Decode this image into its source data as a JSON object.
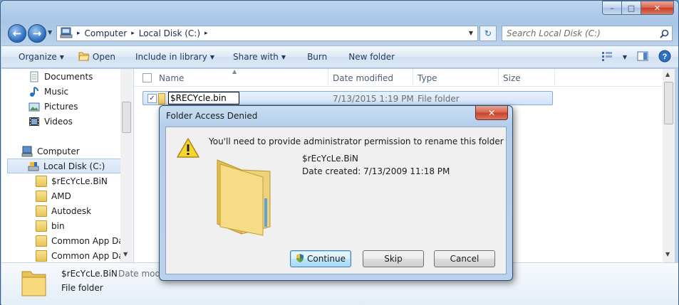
{
  "colors": {
    "title_gradient": "#a9c6e6",
    "selection": "#d2e3f7",
    "close_red": "#c6402a",
    "dialog_body": "#f0f0f0"
  },
  "address_bar": {
    "segments": [
      "Computer",
      "Local Disk (C:)"
    ],
    "separator": "▸"
  },
  "search": {
    "placeholder": "Search Local Disk (C:)"
  },
  "toolbar": {
    "organize": "Organize",
    "open": "Open",
    "include_in_library": "Include in library",
    "share_with": "Share with",
    "burn": "Burn",
    "new_folder": "New folder"
  },
  "nav_pane": {
    "items": [
      {
        "label": "Documents",
        "icon": "documents-icon"
      },
      {
        "label": "Music",
        "icon": "music-icon"
      },
      {
        "label": "Pictures",
        "icon": "pictures-icon"
      },
      {
        "label": "Videos",
        "icon": "videos-icon"
      },
      {
        "label": "Computer",
        "icon": "computer-icon"
      },
      {
        "label": "Local Disk (C:)",
        "icon": "drive-icon"
      },
      {
        "label": "$rEcYcLe.BiN",
        "icon": "folder-icon"
      },
      {
        "label": "AMD",
        "icon": "folder-icon"
      },
      {
        "label": "Autodesk",
        "icon": "folder-icon"
      },
      {
        "label": "bin",
        "icon": "folder-icon"
      },
      {
        "label": "Common App Data",
        "icon": "folder-icon"
      },
      {
        "label": "Common App Data",
        "icon": "folder-icon"
      }
    ]
  },
  "file_list": {
    "columns": [
      "Name",
      "Date modified",
      "Type",
      "Size"
    ],
    "rows": [
      {
        "name": "$RECYcle.bin",
        "date_modified": "7/13/2015 1:19 PM",
        "type": "File folder",
        "checked": true
      }
    ]
  },
  "details_pane": {
    "name": "$rEcYcLe.BiN",
    "modified_label": "Date modifi",
    "type": "File folder"
  },
  "dialog": {
    "title": "Folder Access Denied",
    "close": "✕",
    "message": "You'll need to provide administrator permission to rename this folder",
    "folder_name": "$rEcYcLe.BiN",
    "date_created": "Date created: 7/13/2009 11:18 PM",
    "buttons": {
      "continue": "Continue",
      "skip": "Skip",
      "cancel": "Cancel"
    }
  },
  "window_controls": {
    "minimize": "–",
    "maximize": "□",
    "close": "✕"
  }
}
